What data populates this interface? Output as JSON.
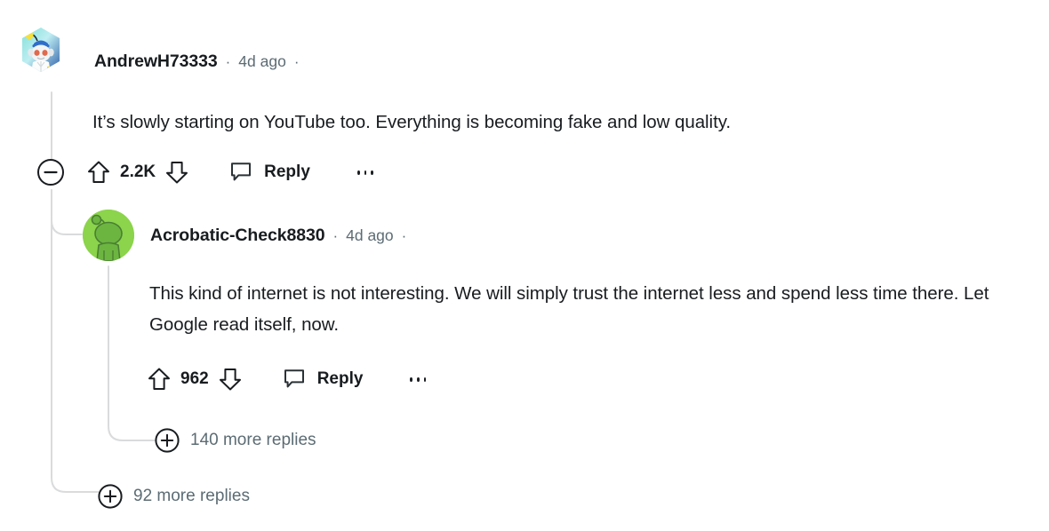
{
  "theme": {
    "background": "#ffffff",
    "text_primary": "#181c1f",
    "text_muted": "#5c6c74",
    "thread_line": "#dadbdc",
    "avatar_green": "#8bd44b"
  },
  "thread": {
    "comments": [
      {
        "id": "comment-1",
        "depth": 0,
        "author": "AndrewH73333",
        "separator": "·",
        "timestamp": "4d ago",
        "trailing_separator": "·",
        "avatar_name": "avatar-snoo-doctor-hex",
        "body": "It’s slowly starting on YouTube too. Everything is becoming fake and low quality.",
        "actions": {
          "collapse_icon": "minus-circle-icon",
          "upvote_icon": "upvote-arrow-icon",
          "score": "2.2K",
          "downvote_icon": "downvote-arrow-icon",
          "reply_icon": "speech-bubble-icon",
          "reply_label": "Reply",
          "overflow_icon": "ellipsis-icon"
        }
      },
      {
        "id": "comment-2",
        "depth": 1,
        "author": "Acrobatic-Check8830",
        "separator": "·",
        "timestamp": "4d ago",
        "trailing_separator": "·",
        "avatar_name": "avatar-snoo-green-circle",
        "body": "This kind of internet is not interesting. We will simply trust the internet less and spend less time there. Let Google read itself, now.",
        "actions": {
          "upvote_icon": "upvote-arrow-icon",
          "score": "962",
          "downvote_icon": "downvote-arrow-icon",
          "reply_icon": "speech-bubble-icon",
          "reply_label": "Reply",
          "overflow_icon": "ellipsis-icon"
        }
      }
    ],
    "more_replies": [
      {
        "id": "more-replies-nested",
        "depth": 2,
        "icon": "plus-circle-icon",
        "label": "140 more replies",
        "count": 140
      },
      {
        "id": "more-replies-root",
        "depth": 1,
        "icon": "plus-circle-icon",
        "label": "92 more replies",
        "count": 92
      }
    ]
  }
}
